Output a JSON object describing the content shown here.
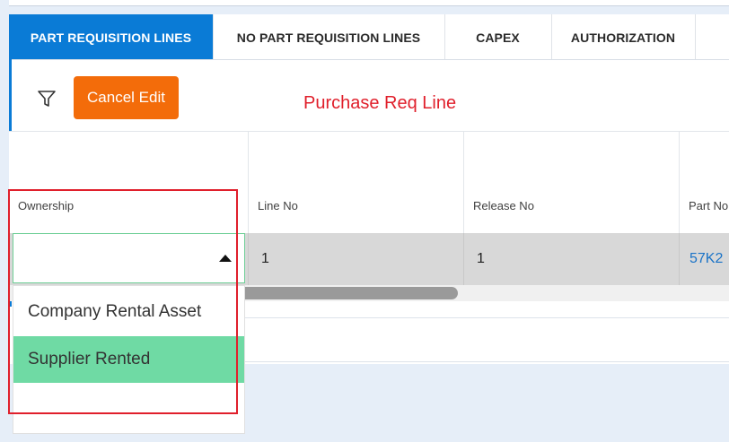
{
  "tabs": [
    {
      "label": "PART REQUISITION LINES",
      "active": true
    },
    {
      "label": "NO PART REQUISITION LINES",
      "active": false
    },
    {
      "label": "CAPEX",
      "active": false
    },
    {
      "label": "AUTHORIZATION",
      "active": false
    }
  ],
  "toolbar": {
    "filter_icon": "filter-icon",
    "cancel_edit_label": "Cancel Edit",
    "annotation": "Purchase Req Line"
  },
  "grid": {
    "columns": [
      "Ownership",
      "Line No",
      "Release No",
      "Part No"
    ],
    "row": {
      "ownership": "",
      "line_no": "1",
      "release_no": "1",
      "part_no": "57K2"
    }
  },
  "dropdown": {
    "options": [
      "Company Rental Asset",
      "Supplier Rented"
    ],
    "selected": "Supplier Rented"
  },
  "colors": {
    "tab_active": "#0a7bd6",
    "cancel_button": "#f36c0a",
    "annotation": "#e01f2b",
    "selected_option": "#6fdaa4"
  }
}
